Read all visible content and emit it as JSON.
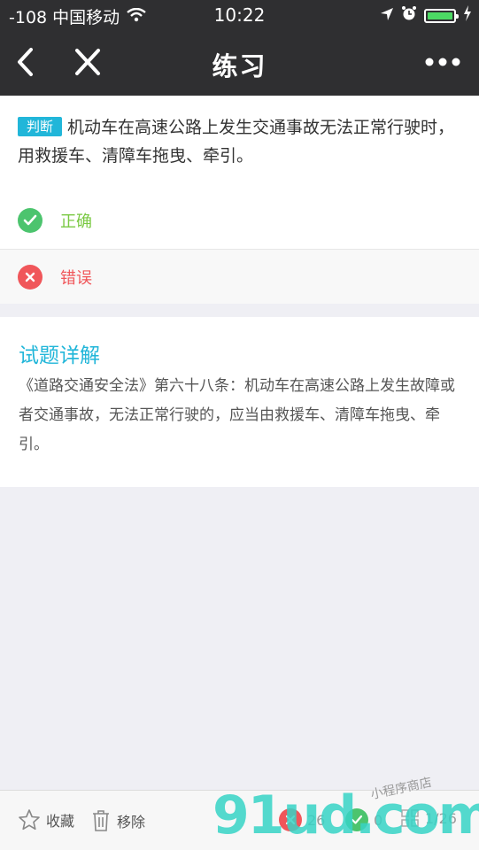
{
  "status": {
    "carrier": "-108 中国移动",
    "time": "10:22"
  },
  "nav": {
    "title": "练习"
  },
  "question": {
    "tag": "判断",
    "text": "机动车在高速公路上发生交通事故无法正常行驶时，用救援车、清障车拖曳、牵引。"
  },
  "options": [
    {
      "label": "正确",
      "color": "#7ac943",
      "icon": "check-icon"
    },
    {
      "label": "错误",
      "color": "#f0565a",
      "icon": "close-icon"
    }
  ],
  "explanation": {
    "title": "试题详解",
    "text": "《道路交通安全法》第六十八条：机动车在高速公路上发生故障或者交通事故，无法正常行驶的，应当由救援车、清障车拖曳、牵引。"
  },
  "bottom": {
    "favorite_label": "收藏",
    "remove_label": "移除",
    "wrong_count": "26",
    "right_count": "0",
    "progress": "1/26"
  },
  "watermark": {
    "logo": "91ud.com",
    "sub": "小程序商店"
  },
  "colors": {
    "bar": "#2f2f31",
    "accent": "#21b6d9",
    "correct": "#7ac943",
    "wrong": "#f0565a"
  }
}
